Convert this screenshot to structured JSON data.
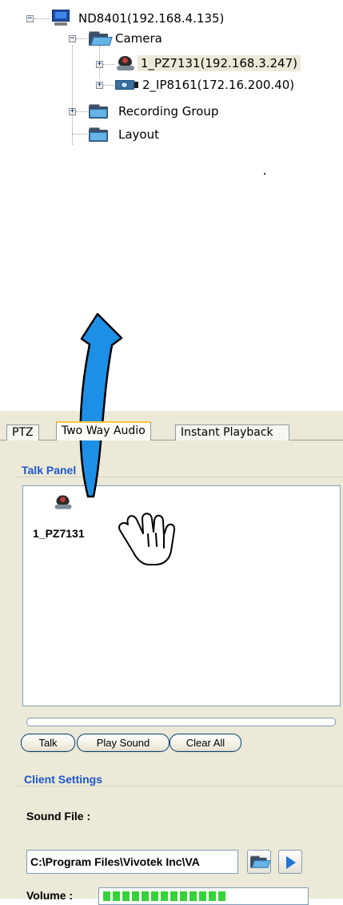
{
  "tree": {
    "nvr_label": "ND8401(192.168.4.135)",
    "camera_folder": "Camera",
    "cameras": [
      {
        "label": "1_PZ7131(192.168.3.247)",
        "selected": true
      },
      {
        "label": "2_IP8161(172.16.200.40)",
        "selected": false
      }
    ],
    "recording_group": "Recording Group",
    "layout": "Layout"
  },
  "tabs": [
    "PTZ",
    "Two Way Audio",
    "Instant Playback"
  ],
  "active_tab": "Two Way Audio",
  "talk_panel": {
    "title": "Talk Panel",
    "items": [
      {
        "label": "1_PZ7131"
      }
    ]
  },
  "buttons": {
    "talk": "Talk",
    "play_sound": "Play Sound",
    "clear_all": "Clear All"
  },
  "client_settings": {
    "title": "Client Settings",
    "sound_file_label": "Sound File :",
    "sound_file_value": "C:\\Program Files\\Vivotek Inc\\VA",
    "volume_label": "Volume :",
    "volume_level": 0.62
  },
  "colors": {
    "accent_blue": "#1b57c8",
    "arrow_blue": "#1e8fe6",
    "volume_green": "#35d337",
    "panel_bg": "#ece9d8"
  },
  "icons": [
    "monitor-icon",
    "folder-open-icon",
    "folder-icon",
    "ptz-camera-icon",
    "box-camera-icon",
    "hand-cursor-icon",
    "open-folder-icon",
    "play-icon",
    "curved-arrow"
  ]
}
